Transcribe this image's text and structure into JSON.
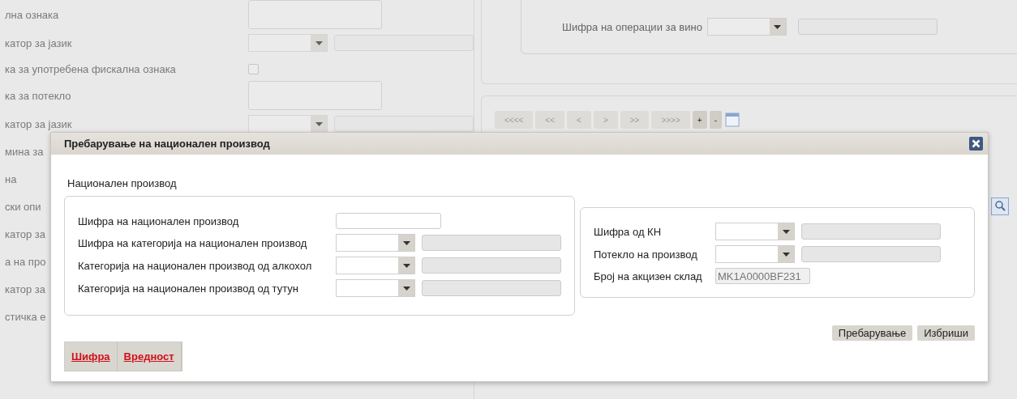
{
  "background": {
    "left_rows": [
      {
        "label": "лна ознака",
        "kind": "textarea"
      },
      {
        "label": "катор за јазик",
        "kind": "select"
      },
      {
        "label": "ка за употребена фискална ознака",
        "kind": "checkbox",
        "checked": false
      },
      {
        "label": "ка за потекло",
        "kind": "textarea"
      },
      {
        "label": "катор за јазик",
        "kind": "select"
      },
      {
        "label": "мина за",
        "kind": "plain"
      },
      {
        "label": "на",
        "kind": "plain"
      },
      {
        "label": "ски опи",
        "kind": "plain"
      },
      {
        "label": "катор за",
        "kind": "plain"
      },
      {
        "label": "а на про",
        "kind": "plain"
      },
      {
        "label": "катор за",
        "kind": "plain"
      },
      {
        "label": "стичка е",
        "kind": "plain"
      }
    ],
    "right_field": {
      "label": "Шифра на операции за вино"
    },
    "pager": [
      {
        "label": "<<<<",
        "disabled": true
      },
      {
        "label": "<<",
        "disabled": true
      },
      {
        "label": "<",
        "disabled": true
      },
      {
        "label": ">",
        "disabled": true
      },
      {
        "label": ">>",
        "disabled": true
      },
      {
        "label": ">>>>",
        "disabled": true
      },
      {
        "label": "+",
        "disabled": false
      },
      {
        "label": "-",
        "disabled": false
      }
    ]
  },
  "dialog": {
    "title": "Пребарување на национален производ",
    "section_title": "Национален производ",
    "left_fields": [
      {
        "label": "Шифра на национален производ",
        "kind": "text"
      },
      {
        "label": "Шифра на категорија на национален производ",
        "kind": "select"
      },
      {
        "label": "Категорија на национален производ од алкохол",
        "kind": "select"
      },
      {
        "label": "Категорија на национален производ од тутун",
        "kind": "select"
      }
    ],
    "right_fields": [
      {
        "label": "Шифра од КН",
        "kind": "select"
      },
      {
        "label": "Потекло на производ",
        "kind": "select"
      },
      {
        "label": "Број на акцизен склад",
        "kind": "readonly",
        "value": "MK1A0000BF231"
      }
    ],
    "buttons": [
      "Пребарување",
      "Избриши"
    ],
    "tabs": [
      {
        "label": "Шифра"
      },
      {
        "label": "Вредност"
      }
    ]
  }
}
